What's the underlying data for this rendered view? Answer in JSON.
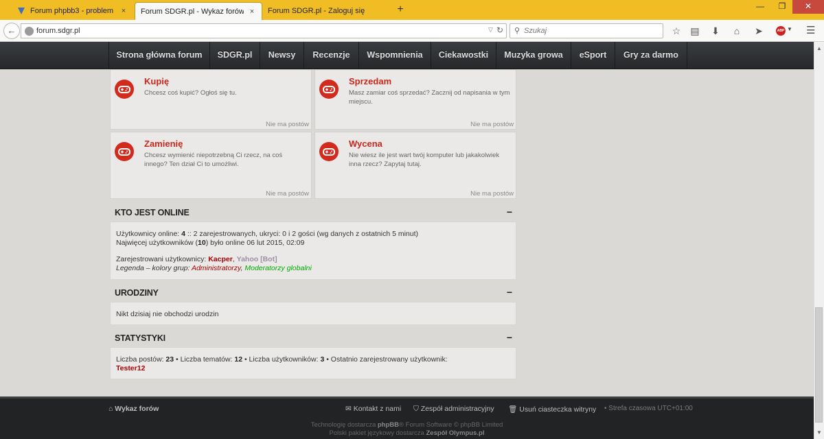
{
  "browser": {
    "tabs": [
      {
        "label": "Forum phpbb3 - problem z...",
        "close": "×"
      },
      {
        "label": "Forum SDGR.pl - Wykaz forów",
        "close": "×"
      },
      {
        "label": "Forum SDGR.pl - Zaloguj się",
        "close": ""
      }
    ],
    "new_tab": "+",
    "url": "forum.sdgr.pl",
    "search_placeholder": "Szukaj",
    "abp_label": "ABP"
  },
  "site_nav": [
    "Strona główna forum",
    "SDGR.pl",
    "Newsy",
    "Recenzje",
    "Wspomnienia",
    "Ciekawostki",
    "Muzyka growa",
    "eSport",
    "Gry za darmo"
  ],
  "forums": [
    {
      "title": "Kupię",
      "desc": "Chcesz coś kupić? Ogłoś się tu.",
      "stat": "Nie ma postów"
    },
    {
      "title": "Sprzedam",
      "desc": "Masz zamiar coś sprzedać? Zacznij od napisania w tym miejscu.",
      "stat": "Nie ma postów"
    },
    {
      "title": "Zamienię",
      "desc": "Chcesz wymienić niepotrzebną Ci rzecz, na coś innego? Ten dział Ci to umożliwi.",
      "stat": "Nie ma postów"
    },
    {
      "title": "Wycena",
      "desc": "Nie wiesz ile jest wart twój komputer lub jakakolwiek inna rzecz? Zapytaj tutaj.",
      "stat": "Nie ma postów"
    }
  ],
  "online": {
    "title": "KTO JEST ONLINE",
    "collapse": "−",
    "line1_pre": "Użytkownicy online: ",
    "line1_count": "4",
    "line1_post": " :: 2 zarejestrowanych, ukryci: 0 i 2 gości (wg danych z ostatnich 5 minut)",
    "line2_pre": "Najwięcej użytkowników (",
    "line2_count": "10",
    "line2_post": ") było online 06 lut 2015, 02:09",
    "reg_pre": "Zarejestrowani użytkownicy: ",
    "reg_user1": "Kacper",
    "reg_sep": ", ",
    "reg_user2": "Yahoo [Bot]",
    "legend_pre": "Legenda – kolory grup: ",
    "legend_admin": "Administratorzy",
    "legend_sep": ", ",
    "legend_mod": "Moderatorzy globalni"
  },
  "birthdays": {
    "title": "URODZINY",
    "collapse": "−",
    "text": "Nikt dzisiaj nie obchodzi urodzin"
  },
  "stats": {
    "title": "STATYSTYKI",
    "collapse": "−",
    "posts_label": "Liczba postów: ",
    "posts": "23",
    "topics_label": " • Liczba tematów: ",
    "topics": "12",
    "users_label": " • Liczba użytkowników: ",
    "users": "3",
    "newest_label": " • Ostatnio zarejestrowany użytkownik:",
    "newest_user": "Tester12"
  },
  "footer": {
    "home": "Wykaz forów",
    "contact": "Kontakt z nami",
    "team": "Zespół administracyjny",
    "cookies": "Usuń ciasteczka witryny",
    "timezone": "• Strefa czasowa UTC+01:00",
    "credit1_pre": "Technologię dostarcza ",
    "credit1_bold": "phpBB",
    "credit1_post": "® Forum Software © phpBB Limited",
    "credit2_pre": "Polski pakiet językowy dostarcza ",
    "credit2_bold": "Zespół Olympus.pl"
  },
  "colors": {
    "tabbar": "#f0bd24",
    "accent_red": "#c8281c",
    "admin": "#aa0000",
    "moderator": "#00aa00",
    "bot": "#9e8da7"
  }
}
